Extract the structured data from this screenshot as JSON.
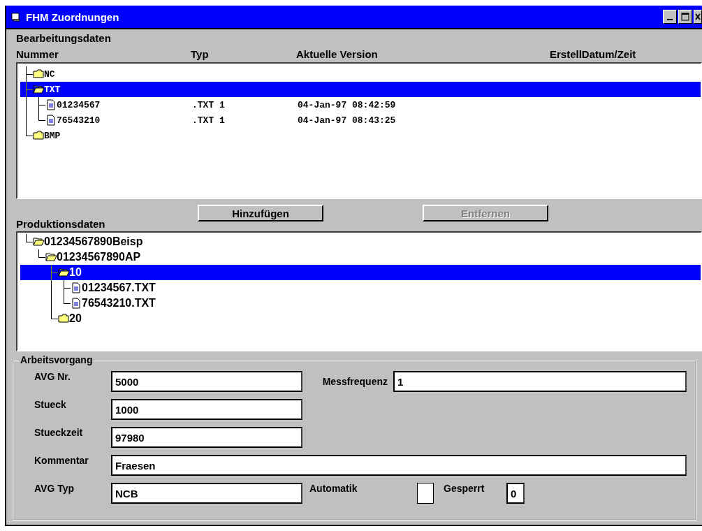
{
  "window": {
    "title": "FHM Zuordnungen"
  },
  "bearbeitung": {
    "title": "Bearbeitungsdaten",
    "columns": [
      "Nummer",
      "Typ",
      "Aktuelle Version",
      "ErstellDatum/Zeit"
    ],
    "tree": [
      {
        "name": "NC",
        "kind": "folder",
        "expanded": false,
        "selected": false
      },
      {
        "name": "TXT",
        "kind": "folder",
        "expanded": true,
        "selected": true,
        "children": [
          {
            "name": "01234567",
            "kind": "file",
            "selected": false,
            "typ": ".TXT 1",
            "version": "04-Jan-97 08:42:59"
          },
          {
            "name": "76543210",
            "kind": "file",
            "selected": false,
            "typ": ".TXT 1",
            "version": "04-Jan-97 08:43:25"
          }
        ]
      },
      {
        "name": "BMP",
        "kind": "folder",
        "expanded": false,
        "selected": false
      }
    ]
  },
  "buttons": [
    {
      "label": "Hinzufügen",
      "disabled": false
    },
    {
      "label": "Entfernen",
      "disabled": true
    }
  ],
  "produktion": {
    "title": "Produktionsdaten",
    "tree": [
      {
        "name": "01234567890Beisp",
        "kind": "folder",
        "expanded": true,
        "selected": false,
        "children": [
          {
            "name": "01234567890AP",
            "kind": "folder",
            "expanded": true,
            "selected": false,
            "children": [
              {
                "name": "10",
                "kind": "folder",
                "expanded": true,
                "selected": true,
                "children": [
                  {
                    "name": "01234567.TXT",
                    "kind": "file",
                    "selected": false
                  },
                  {
                    "name": "76543210.TXT",
                    "kind": "file",
                    "selected": false
                  }
                ]
              },
              {
                "name": "20",
                "kind": "folder",
                "expanded": false,
                "selected": false
              }
            ]
          }
        ]
      }
    ]
  },
  "arbeitsvorgang": {
    "title": "Arbeitsvorgang",
    "avg_nr": {
      "label": "AVG Nr.",
      "value": "5000"
    },
    "messfrequenz": {
      "label": "Messfrequenz",
      "value": "1"
    },
    "stueck": {
      "label": "Stueck",
      "value": "1000"
    },
    "stueckzeit": {
      "label": "Stueckzeit",
      "value": "97980"
    },
    "kommentar": {
      "label": "Kommentar",
      "value": "Fraesen"
    },
    "avg_typ": {
      "label": "AVG Typ",
      "value": "NCB"
    },
    "automatik": {
      "label": "Automatik",
      "checked": false
    },
    "gesperrt": {
      "label": "Gesperrt",
      "value": "0"
    }
  }
}
